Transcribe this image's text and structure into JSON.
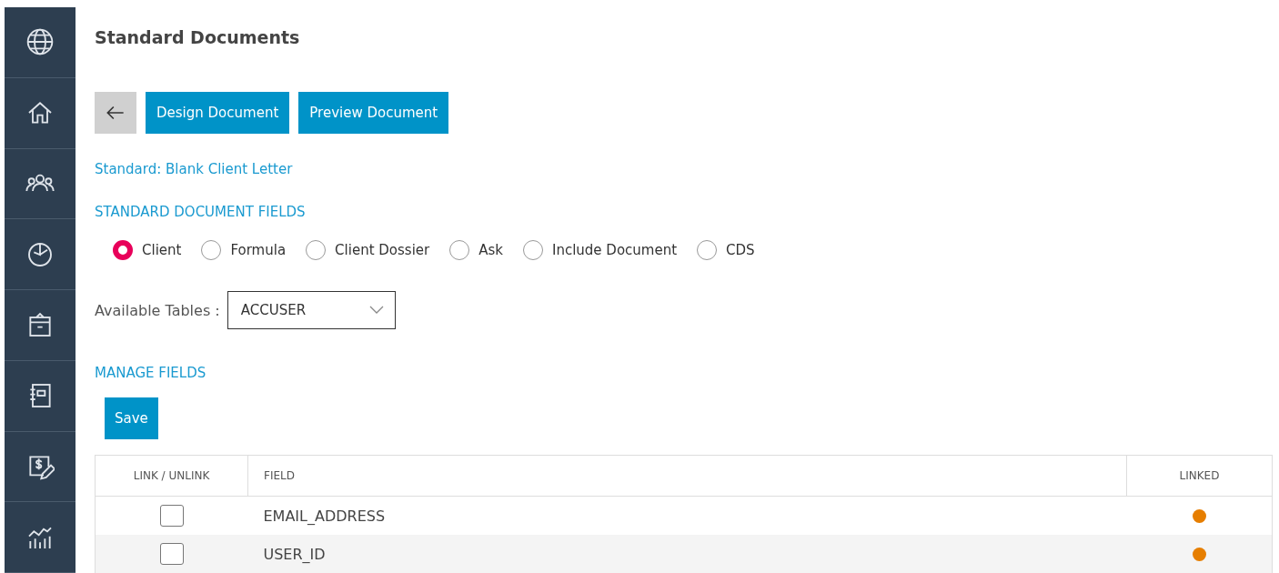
{
  "sidebar": {
    "items": [
      {
        "kind": "globe"
      },
      {
        "kind": "home"
      },
      {
        "kind": "people"
      },
      {
        "kind": "clock"
      },
      {
        "kind": "box"
      },
      {
        "kind": "notebook"
      },
      {
        "kind": "invoice"
      },
      {
        "kind": "chart"
      }
    ]
  },
  "page_title": "Standard Documents",
  "toolbar": {
    "buttons": [
      "Design Document",
      "Preview Document"
    ]
  },
  "standard_link": "Standard: Blank Client Letter",
  "fields_heading": "STANDARD DOCUMENT FIELDS",
  "field_types": [
    {
      "label": "Client",
      "selected": true
    },
    {
      "label": "Formula",
      "selected": false
    },
    {
      "label": "Client Dossier",
      "selected": false
    },
    {
      "label": "Ask",
      "selected": false
    },
    {
      "label": "Include Document",
      "selected": false
    },
    {
      "label": "CDS",
      "selected": false
    }
  ],
  "available_tables": {
    "label": "Available Tables :",
    "value": "ACCUSER"
  },
  "manage_heading": "MANAGE FIELDS",
  "save_button": "Save",
  "table": {
    "columns": [
      "LINK / UNLINK",
      "FIELD",
      "LINKED"
    ],
    "rows": [
      {
        "checked": false,
        "field": "EMAIL_ADDRESS",
        "color": "#e67e00"
      },
      {
        "checked": false,
        "field": "USER_ID",
        "color": "#e67e00"
      }
    ]
  }
}
